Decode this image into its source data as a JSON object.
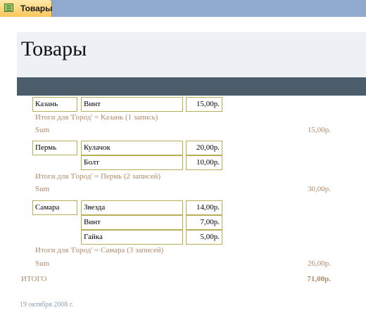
{
  "tab": {
    "label": "Товары",
    "icon": "report-icon"
  },
  "report": {
    "title": "Товары"
  },
  "groups": [
    {
      "city": "Казань",
      "rows": [
        {
          "product": "Винт",
          "price": "15,00р."
        }
      ],
      "summary": "Итоги для 'Город' =  Казань (1 запись)",
      "sum_label": "Sum",
      "sum_value": "15,00р."
    },
    {
      "city": "Пермь",
      "rows": [
        {
          "product": "Кулачок",
          "price": "20,00р."
        },
        {
          "product": "Болт",
          "price": "10,00р."
        }
      ],
      "summary": "Итоги для 'Город' =  Пермь (2 записей)",
      "sum_label": "Sum",
      "sum_value": "30,00р."
    },
    {
      "city": "Самара",
      "rows": [
        {
          "product": "Звезда",
          "price": "14,00р."
        },
        {
          "product": "Винт",
          "price": "7,00р."
        },
        {
          "product": "Гайка",
          "price": "5,00р."
        }
      ],
      "summary": "Итоги для 'Город' =  Самара (3 записей)",
      "sum_label": "Sum",
      "sum_value": "26,00р."
    }
  ],
  "grand_total": {
    "label": "ИТОГО",
    "value": "71,00р."
  },
  "footer": {
    "date": "19 октября 2008 г."
  },
  "colors": {
    "tab_bg": "#f9c65a",
    "tabstrip_bg": "#8fa9cf",
    "header_band": "#edf0f4",
    "dark_band": "#4b5d6b",
    "cell_border": "#b9ad56",
    "summary_text": "#b08a6a",
    "footer_text": "#8aa0b4"
  }
}
